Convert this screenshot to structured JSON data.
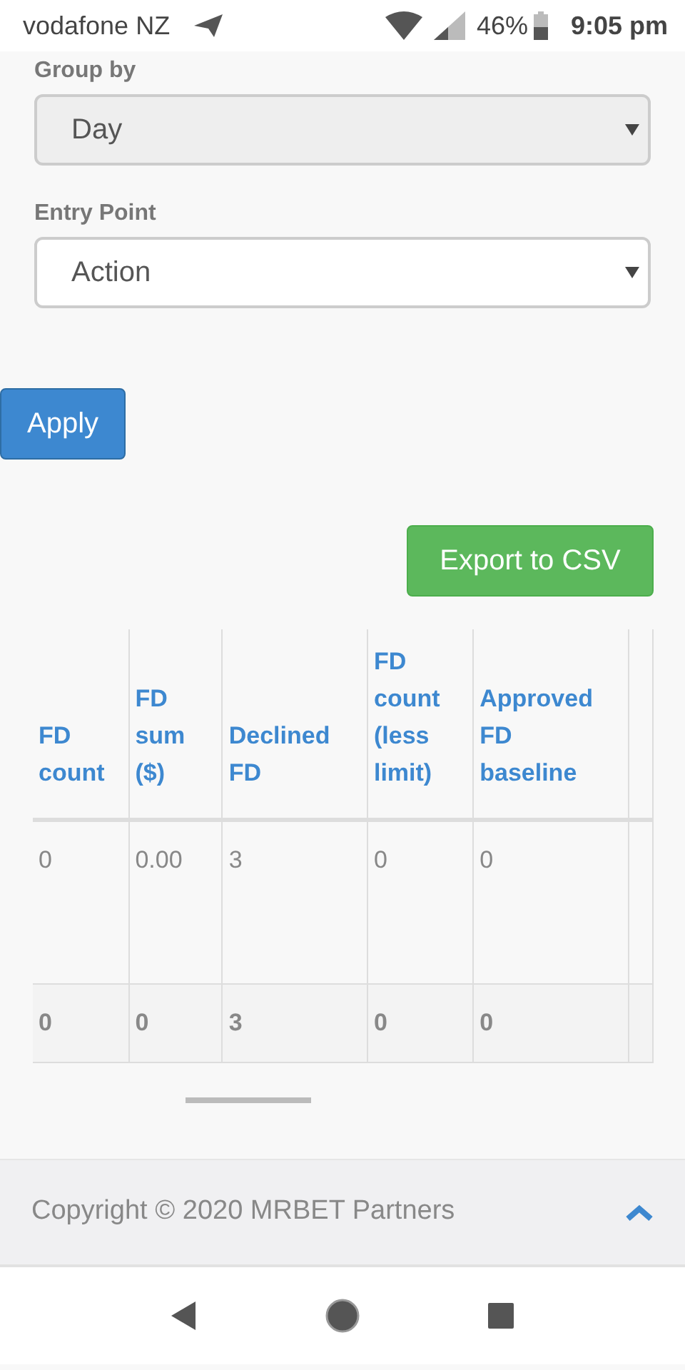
{
  "status_bar": {
    "carrier": "vodafone NZ",
    "battery": "46%",
    "time": "9:05 pm"
  },
  "filters": [
    {
      "label": "Group by",
      "value": "Day",
      "disabled": true
    },
    {
      "label": "Entry Point",
      "value": "Action",
      "disabled": false
    }
  ],
  "apply_button": "Apply",
  "export_button": "Export to CSV",
  "table": {
    "columns": [
      "FD count",
      "FD sum ($)",
      "Declined FD",
      "FD count (less limit)",
      "Approved FD baseline"
    ],
    "rows": [
      [
        "0",
        "0.00",
        "3",
        "0",
        "0"
      ]
    ],
    "totals": [
      "0",
      "0",
      "3",
      "0",
      "0"
    ]
  },
  "footer": {
    "copyright": "Copyright © 2020 MRBET Partners"
  }
}
